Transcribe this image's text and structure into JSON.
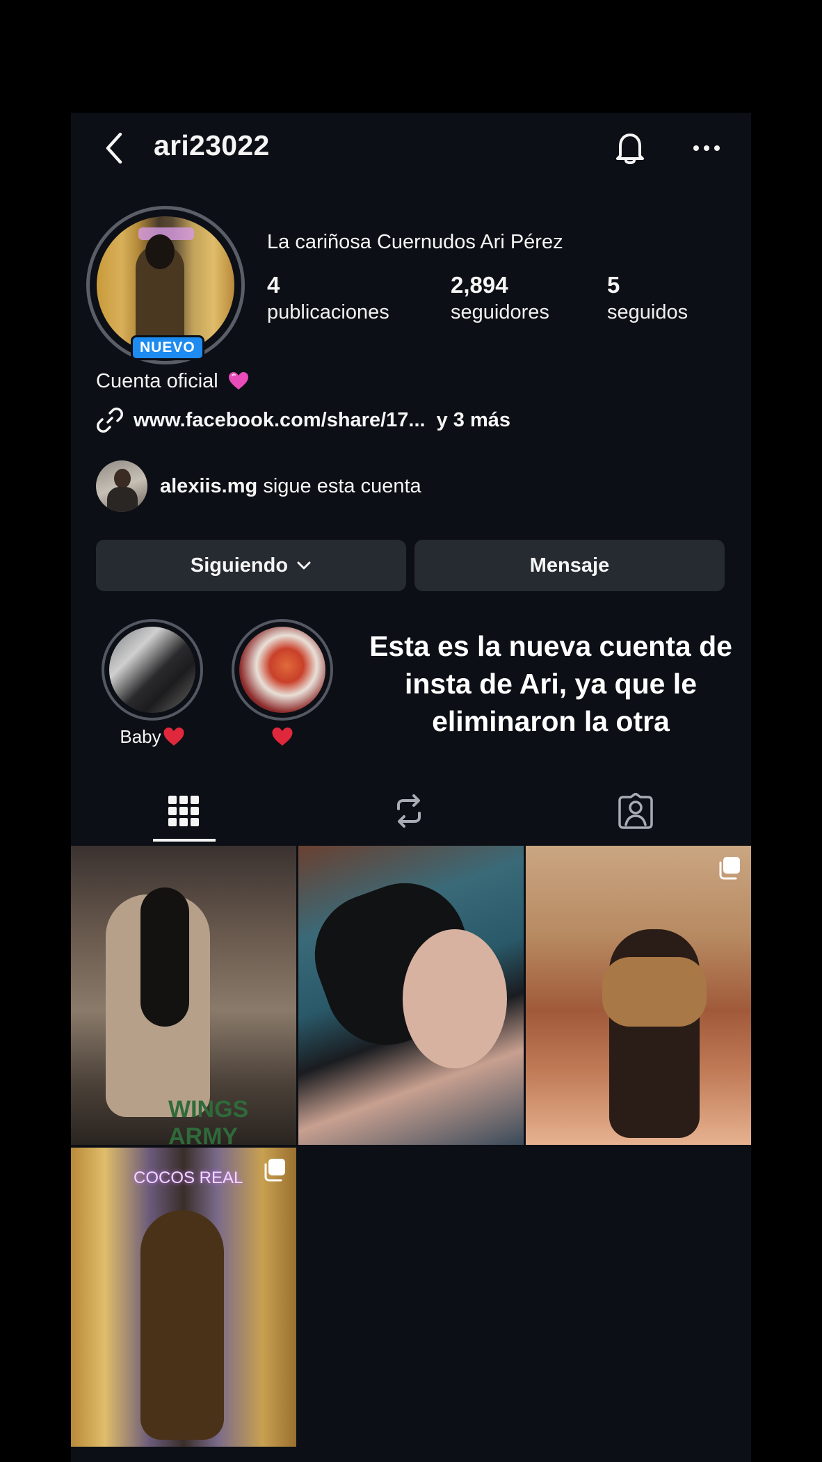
{
  "header": {
    "username": "ari23022"
  },
  "profile": {
    "display_name": "La cariñosa Cuernudos Ari Pérez",
    "badge": "NUEVO",
    "stats": {
      "posts": {
        "value": "4",
        "label": "publicaciones"
      },
      "followers": {
        "value": "2,894",
        "label": "seguidores"
      },
      "following": {
        "value": "5",
        "label": "seguidos"
      }
    },
    "bio": "Cuenta oficial",
    "link": {
      "text": "www.facebook.com/share/17...",
      "more": "y 3 más"
    },
    "followed_by": {
      "username": "alexiis.mg",
      "text": "sigue esta cuenta"
    }
  },
  "buttons": {
    "following": "Siguiendo",
    "message": "Mensaje"
  },
  "highlights": [
    {
      "label": "Baby"
    },
    {
      "label": ""
    }
  ],
  "overlay_caption": "Esta es la nueva cuenta de insta de Ari, ya que le eliminaron la otra",
  "posts": [
    {
      "sign_text": "WINGS ARMY"
    },
    {},
    {
      "multi": true
    },
    {
      "neon_text": "COCOS REAL",
      "multi": true
    }
  ],
  "colors": {
    "background": "#0c0f15",
    "button_bg": "#262a31",
    "badge_blue": "#1d8bf0",
    "heart_red": "#e0283c",
    "heart_pink": "#e94bb8"
  },
  "icons": {
    "back": "chevron-left-icon",
    "bell": "bell-icon",
    "more": "more-horizontal-icon",
    "link": "link-icon",
    "grid": "grid-icon",
    "reels": "repost-icon",
    "tagged": "tagged-person-icon"
  }
}
